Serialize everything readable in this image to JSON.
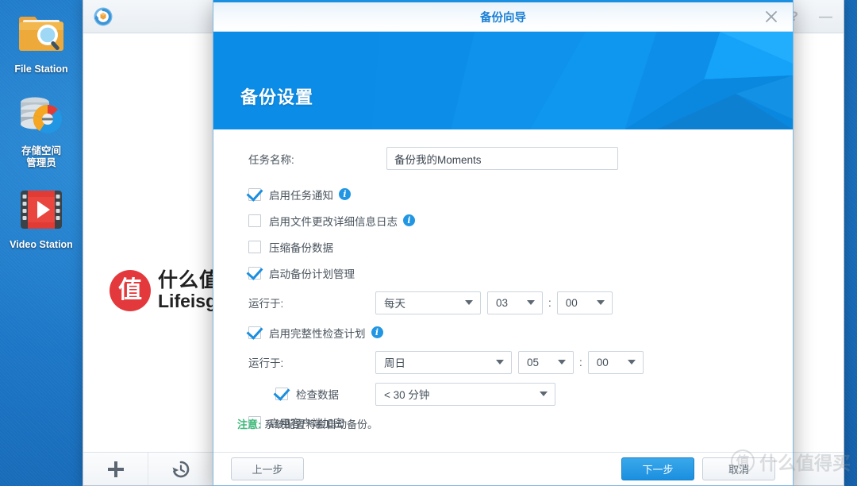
{
  "desktop": {
    "icons": [
      {
        "label": "File Station",
        "icon": "folder-search-icon"
      },
      {
        "label": "存储空间\n管理员",
        "icon": "storage-manager-icon"
      },
      {
        "label": "Video Station",
        "icon": "video-station-icon"
      }
    ]
  },
  "background_window": {
    "app_icon": "hyper-backup-icon",
    "help_label": "?",
    "minimize_label": "—",
    "toolbar": {
      "add_label": "+",
      "restore_icon": "history-restore-icon"
    }
  },
  "watermark": {
    "badge": "值",
    "cn": "什么值得买",
    "en": "Lifeisgood",
    "corner_badge": "值",
    "corner_cn": "什么值得买"
  },
  "dialog": {
    "title": "备份向导",
    "close_icon": "close-icon",
    "banner_title": "备份设置",
    "accent_color": "#1b8fe0",
    "banner_color": "#0b8ce6",
    "task_name": {
      "label": "任务名称:",
      "value": "备份我的Moments",
      "placeholder": "任务名称"
    },
    "options": [
      {
        "label": "启用任务通知",
        "checked": true,
        "info": true,
        "indent": 1
      },
      {
        "label": "启用文件更改详细信息日志",
        "checked": false,
        "info": true,
        "indent": 1
      },
      {
        "label": "压缩备份数据",
        "checked": false,
        "info": false,
        "indent": 1
      },
      {
        "label": "启动备份计划管理",
        "checked": true,
        "info": false,
        "indent": 1
      }
    ],
    "backup_schedule": {
      "label": "运行于:",
      "frequency": "每天",
      "hour": "03",
      "separator": ":",
      "minute": "00"
    },
    "integrity_option": {
      "label": "启用完整性检查计划",
      "checked": true,
      "info": true
    },
    "integrity_schedule": {
      "label": "运行于:",
      "frequency": "周日",
      "hour": "05",
      "separator": ":",
      "minute": "00"
    },
    "check_data": {
      "label": "检查数据",
      "checked": true,
      "duration": "< 30 分钟"
    },
    "client_encryption": {
      "label": "启用客户端加密",
      "checked": false
    },
    "note": {
      "key": "注意:",
      "text": " 系统配置将会自动备份。"
    },
    "footer": {
      "previous": "上一步",
      "next": "下一步",
      "cancel": "取消"
    }
  }
}
